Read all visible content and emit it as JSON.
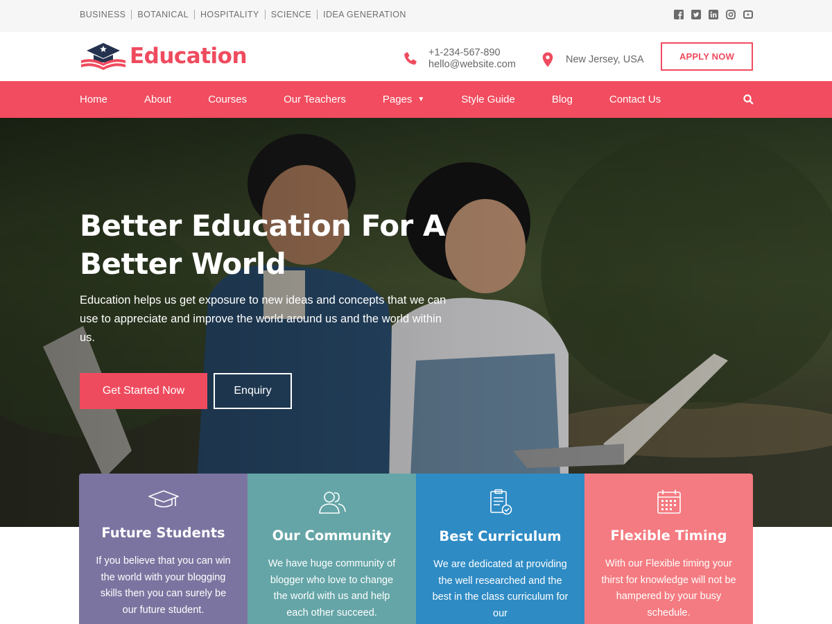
{
  "topbar": {
    "categories": [
      "BUSINESS",
      "BOTANICAL",
      "HOSPITALITY",
      "SCIENCE",
      "IDEA GENERATION"
    ],
    "social_icons": [
      "facebook-icon",
      "twitter-icon",
      "linkedin-icon",
      "instagram-icon",
      "youtube-icon"
    ]
  },
  "header": {
    "logo_text": "Education",
    "phone": "+1-234-567-890",
    "email": "hello@website.com",
    "location": "New Jersey, USA",
    "apply_label": "APPLY NOW"
  },
  "nav": {
    "items": [
      {
        "label": "Home"
      },
      {
        "label": "About"
      },
      {
        "label": "Courses"
      },
      {
        "label": "Our Teachers"
      },
      {
        "label": "Pages",
        "has_dropdown": true
      },
      {
        "label": "Style Guide"
      },
      {
        "label": "Blog"
      },
      {
        "label": "Contact Us"
      }
    ],
    "search_icon": "search-icon"
  },
  "hero": {
    "title": "Better Education For A Better World",
    "description": "Education helps us get exposure to new ideas and concepts that we can use to appreciate and improve the world around us and the world within us.",
    "primary_button": "Get Started Now",
    "secondary_button": "Enquiry"
  },
  "features": [
    {
      "icon": "graduation-cap-icon",
      "title": "Future Students",
      "text": "If you believe that you can win the world with your blogging skills then you can surely be our future student.",
      "color": "#7c74a0"
    },
    {
      "icon": "community-icon",
      "title": "Our Community",
      "text": "We have huge community of blogger who love to change the world with us and help each other succeed.",
      "color": "#65a5a7"
    },
    {
      "icon": "curriculum-icon",
      "title": "Best Curriculum",
      "text": "We are dedicated at providing the well researched and the best in the class curriculum for our",
      "color": "#2e8bc4"
    },
    {
      "icon": "calendar-icon",
      "title": "Flexible Timing",
      "text": "With our Flexible timing your thirst for knowledge will not be hampered by your busy schedule.",
      "color": "#f47b81"
    }
  ],
  "colors": {
    "brand": "#ef4b5e",
    "nav": "#f14c5f",
    "topbar": "#f6f6f6"
  }
}
